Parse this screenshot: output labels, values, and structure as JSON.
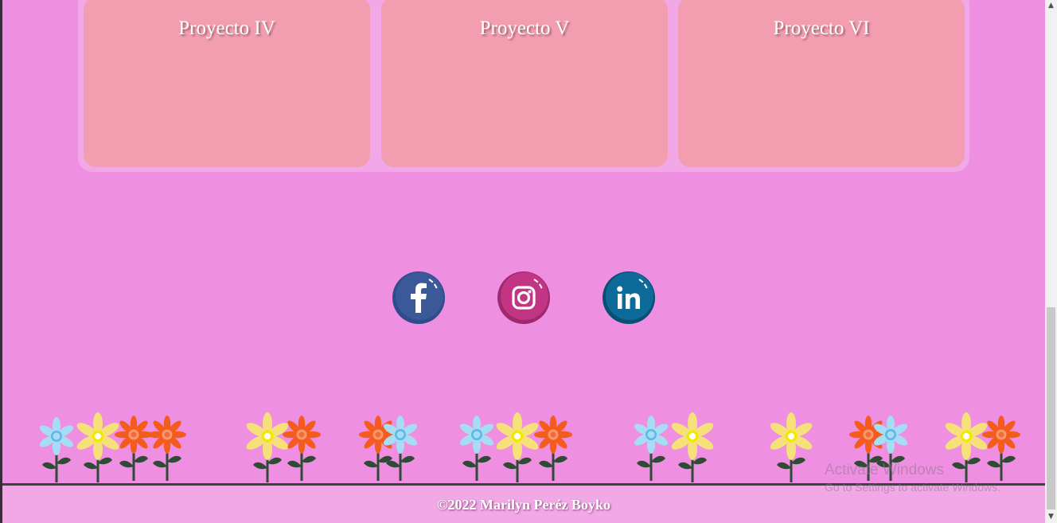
{
  "projects": [
    {
      "title": "Proyecto IV"
    },
    {
      "title": "Proyecto V"
    },
    {
      "title": "Proyecto VI"
    }
  ],
  "social": [
    {
      "name": "facebook",
      "icon": "facebook-icon",
      "color": "#3b5998"
    },
    {
      "name": "instagram",
      "icon": "instagram-icon",
      "color": "#c13584"
    },
    {
      "name": "linkedin",
      "icon": "linkedin-icon",
      "color": "#0e6a98"
    }
  ],
  "footer": {
    "copyright": "©2022 Marilyn Peréz Boyko"
  },
  "watermark": {
    "title": "Activate Windows",
    "subtitle": "Go to Settings to activate Windows."
  },
  "colors": {
    "background": "#ee8fe1",
    "panel": "#f2a7e6",
    "card": "#f29eb0",
    "flower_blue": "#a6ddf5",
    "flower_yellow": "#f5e07a",
    "flower_orange": "#f45c1e",
    "stem": "#2f4a35"
  }
}
